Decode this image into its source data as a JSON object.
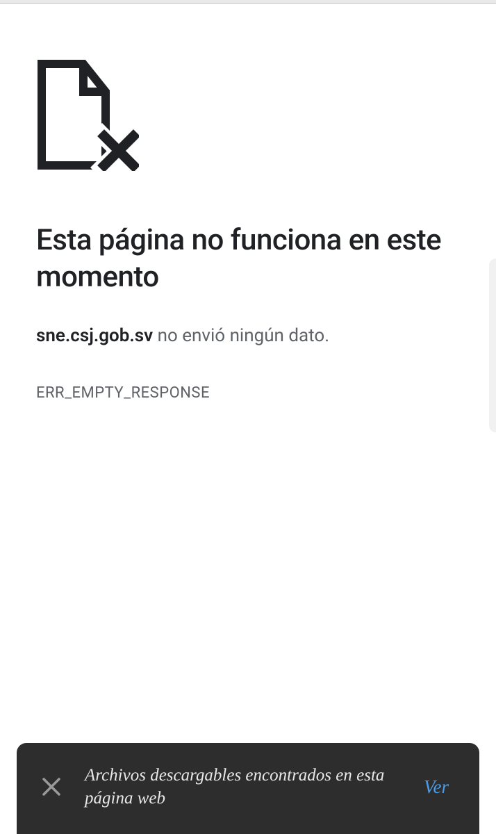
{
  "error": {
    "title": "Esta página no funciona en este momento",
    "domain": "sne.csj.gob.sv",
    "message_suffix": " no envió ningún dato.",
    "code": "ERR_EMPTY_RESPONSE"
  },
  "toast": {
    "text": "Archivos descargables encontrados en esta página web",
    "action_label": "Ver"
  }
}
